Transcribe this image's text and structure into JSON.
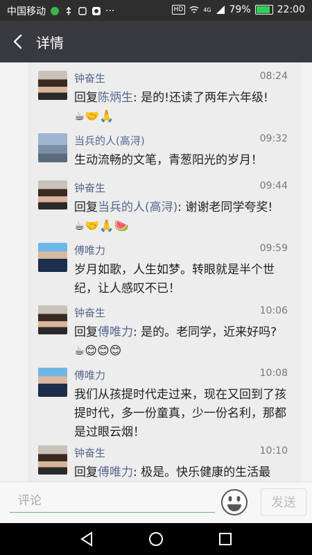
{
  "status_bar": {
    "carrier": "中国移动",
    "hd": "HD",
    "network": "4G",
    "battery_percent": "79%",
    "battery_level": 0.79,
    "time": "22:00"
  },
  "header": {
    "title": "详情"
  },
  "comments": [
    {
      "author": "钟奋生",
      "time": "08:24",
      "reply_prefix": "回复",
      "reply_to": "陈炳生",
      "text": ": 是的!还读了两年六年级!",
      "emojis": "☕🤝🙏"
    },
    {
      "author": "当兵的人(高浔)",
      "time": "09:32",
      "reply_prefix": "",
      "reply_to": "",
      "text": "生动流畅的文笔，青葱阳光的岁月！",
      "emojis": ""
    },
    {
      "author": "钟奋生",
      "time": "09:44",
      "reply_prefix": "回复",
      "reply_to": "当兵的人(高浔)",
      "text": ": 谢谢老同学夸奖!",
      "emojis": "☕🤝🙏🍉"
    },
    {
      "author": "傅唯力",
      "time": "09:59",
      "reply_prefix": "",
      "reply_to": "",
      "text": "岁月如歌，人生如梦。转眼就是半个世纪，让人感叹不已！",
      "emojis": ""
    },
    {
      "author": "钟奋生",
      "time": "10:06",
      "reply_prefix": "回复",
      "reply_to": "傅唯力",
      "text": ": 是的。老同学，近来好吗?",
      "emojis": "☕😊😊😊"
    },
    {
      "author": "傅唯力",
      "time": "10:08",
      "reply_prefix": "",
      "reply_to": "",
      "text": "我们从孩提时代走过来，现在又回到了孩提时代，多一份童真，少一份名利，那都是过眼云烟！",
      "emojis": ""
    },
    {
      "author": "钟奋生",
      "time": "10:10",
      "reply_prefix": "回复",
      "reply_to": "傅唯力",
      "text": ": 极是。快乐健康的生活最",
      "emojis": ""
    }
  ],
  "input_bar": {
    "placeholder": "评论",
    "send_label": "发送"
  },
  "colors": {
    "name_link": "#57688e",
    "header_bg": "#393a3f",
    "input_accent": "#5fb878"
  }
}
